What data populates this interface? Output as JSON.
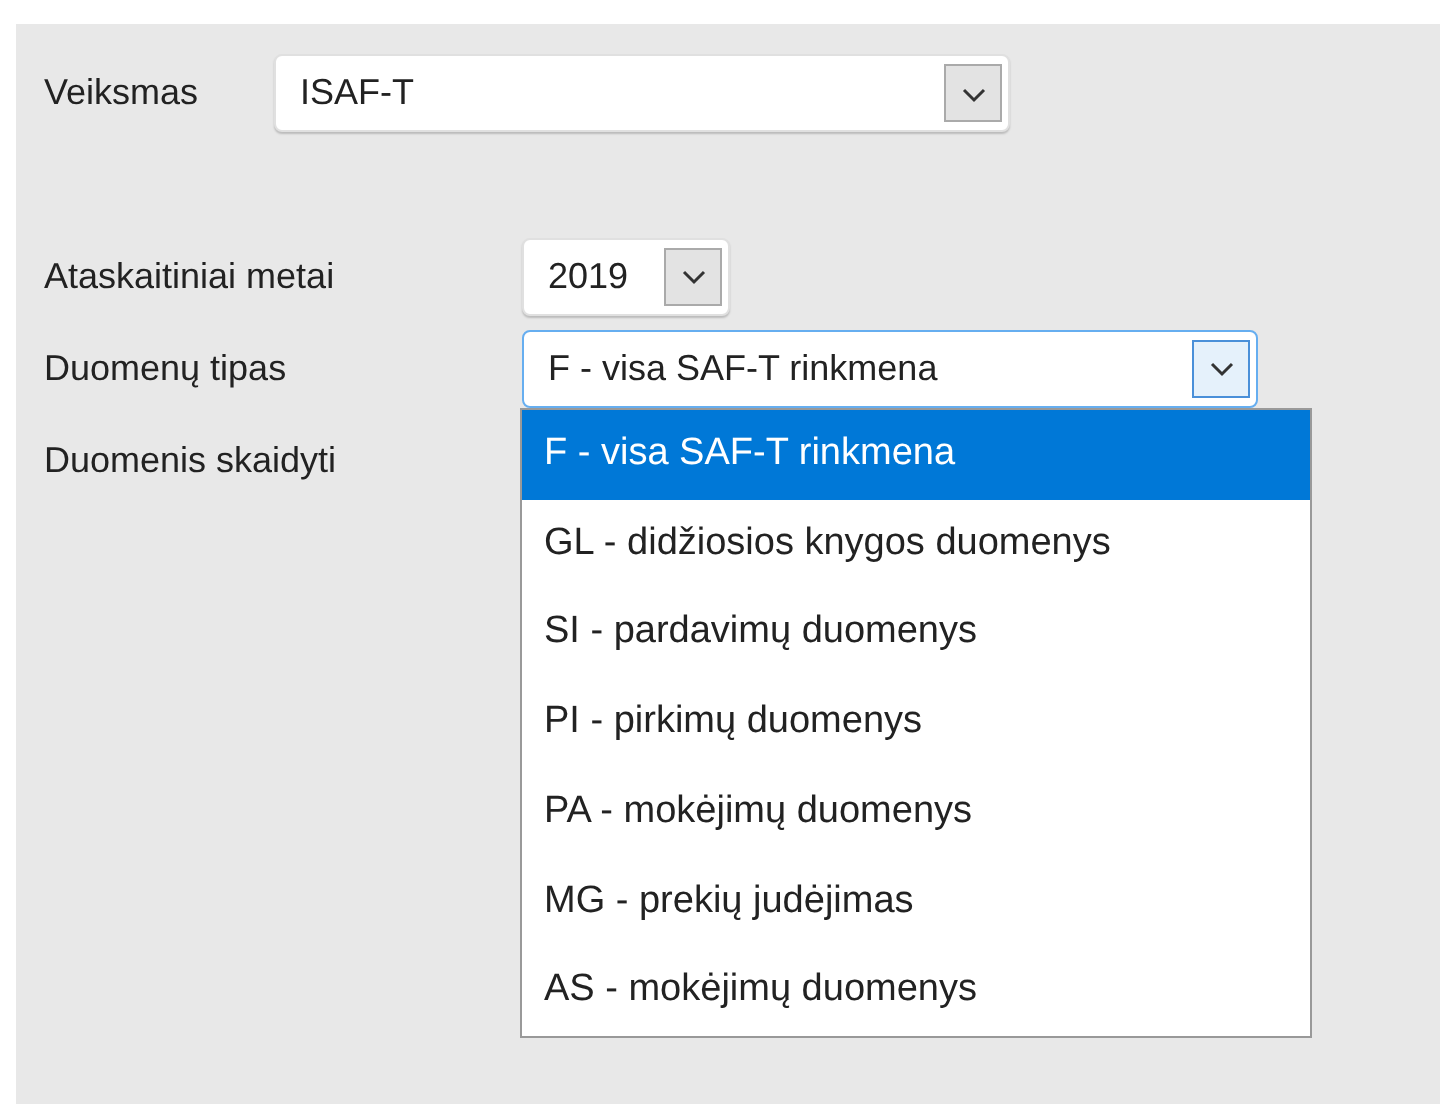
{
  "action": {
    "label": "Veiksmas",
    "value": "ISAF-T"
  },
  "fields": [
    {
      "label": "Ataskaitiniai metai",
      "kind": "year",
      "value": "2019",
      "focused": false
    },
    {
      "label": "Duomenų tipas",
      "kind": "type",
      "value": "F - visa SAF-T rinkmena",
      "focused": true
    },
    {
      "label": "Duomenis skaidyti",
      "kind": "plain"
    }
  ],
  "dropdown": {
    "options": [
      {
        "label": "F - visa SAF-T rinkmena",
        "selected": true
      },
      {
        "label": "GL - didžiosios knygos duomenys",
        "selected": false
      },
      {
        "label": "SI - pardavimų duomenys",
        "selected": false
      },
      {
        "label": "PI - pirkimų duomenys",
        "selected": false
      },
      {
        "label": "PA - mokėjimų duomenys",
        "selected": false
      },
      {
        "label": "MG - prekių judėjimas",
        "selected": false
      },
      {
        "label": "AS - mokėjimų duomenys",
        "selected": false
      }
    ]
  }
}
